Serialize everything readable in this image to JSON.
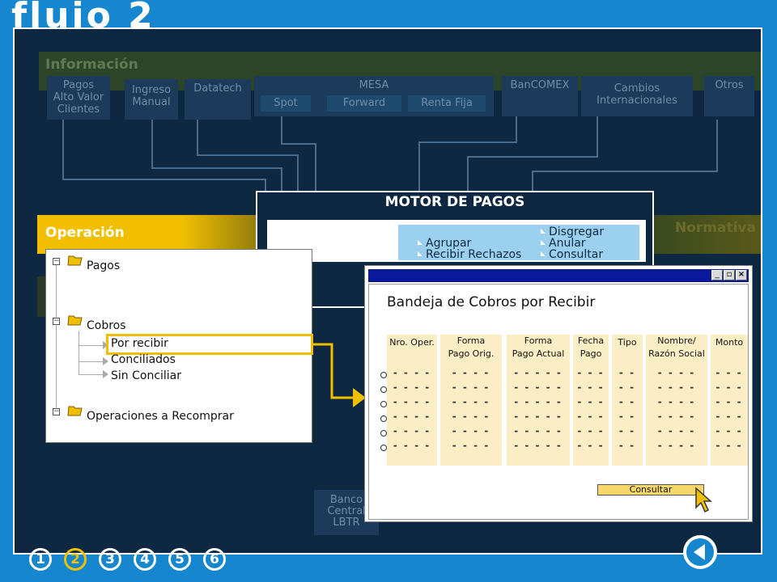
{
  "header": {
    "title": "flujo 2"
  },
  "diagram": {
    "info_label": "Información",
    "sources": [
      {
        "label": "Pagos\nAlto Valor\nClientes"
      },
      {
        "label": "Ingreso\nManual"
      },
      {
        "label": "Datatech"
      },
      {
        "label": "MESA"
      },
      {
        "label": "BanCOMEX"
      },
      {
        "label": "Cambios\nInternacionales"
      },
      {
        "label": "Otros"
      }
    ],
    "mesa_subs": [
      "Spot",
      "Forward",
      "Renta Fija"
    ],
    "motor_title": "MOTOR DE PAGOS",
    "motor_actions": [
      "Agrupar",
      "Recibir Rechazos",
      "Disgregar",
      "Anular",
      "Consultar"
    ],
    "operacion_label": "Operación",
    "normativa_label": "Normativa",
    "lbtr_label": "Banco\nCentral\nLBTR"
  },
  "tree": {
    "pagos": "Pagos",
    "cobros": "Cobros",
    "por_recibir": "Por recibir",
    "conciliados": "Conciliados",
    "sin_conciliar": "Sin Conciliar",
    "recomprar": "Operaciones a Recomprar"
  },
  "window": {
    "title": "Bandeja de Cobros por Recibir",
    "columns": [
      "Nro. Oper.",
      "Forma\nPago Orig.",
      "Forma\nPago Actual",
      "Fecha\nPago",
      "Tipo",
      "Nombre/\nRazón Social",
      "Monto"
    ],
    "row_placeholders": [
      "- - - -",
      "- - - -",
      "- - - - -",
      "- - -",
      "- -",
      "- - - -",
      "- - -"
    ],
    "consultar_label": "Consultar"
  },
  "nav": {
    "steps": [
      "1",
      "2",
      "3",
      "4",
      "5",
      "6"
    ],
    "active_step": "2"
  },
  "colors": {
    "accent": "#f0c000",
    "background": "#1687cf",
    "stage": "#0d2840",
    "window_bar": "#0a1a9a"
  }
}
